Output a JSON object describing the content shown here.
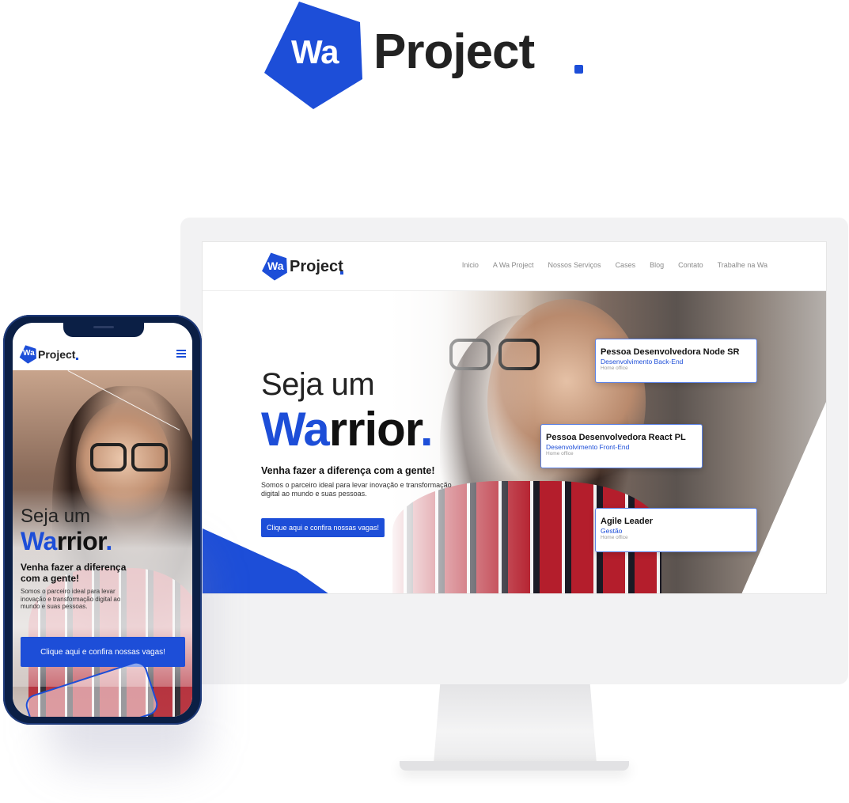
{
  "brand": {
    "logo_mark_text": "Wa",
    "logo_word": "Project",
    "accent_color": "#1d4ed8"
  },
  "desktop": {
    "nav": [
      "Inicio",
      "A Wa Project",
      "Nossos Serviços",
      "Cases",
      "Blog",
      "Contato",
      "Trabalhe na Wa"
    ],
    "hero": {
      "title_light": "Seja um",
      "title_bold_accent": "Wa",
      "title_bold_rest": "rrior",
      "title_dot": ".",
      "subtitle": "Venha fazer a diferença com a gente!",
      "description": "Somos o parceiro ideal para levar inovação e transformação digital ao mundo e suas pessoas.",
      "cta_label": "Clique aqui e confira nossas vagas!"
    },
    "jobs": [
      {
        "title": "Pessoa Desenvolvedora Node SR",
        "category": "Desenvolvimento Back-End",
        "location": "Home office"
      },
      {
        "title": "Pessoa Desenvolvedora React PL",
        "category": "Desenvolvimento Front-End",
        "location": "Home office"
      },
      {
        "title": "Agile Leader",
        "category": "Gestão",
        "location": "Home office"
      }
    ]
  },
  "mobile": {
    "hero": {
      "title_light": "Seja um",
      "title_bold_accent": "Wa",
      "title_bold_rest": "rrior",
      "title_dot": ".",
      "subtitle": "Venha fazer a diferença com a gente!",
      "description": "Somos o parceiro ideal para levar inovação e transformação digital ao mundo e suas pessoas.",
      "cta_label": "Clique aqui e confira nossas vagas!"
    },
    "menu_icon": "hamburger-menu-icon"
  }
}
